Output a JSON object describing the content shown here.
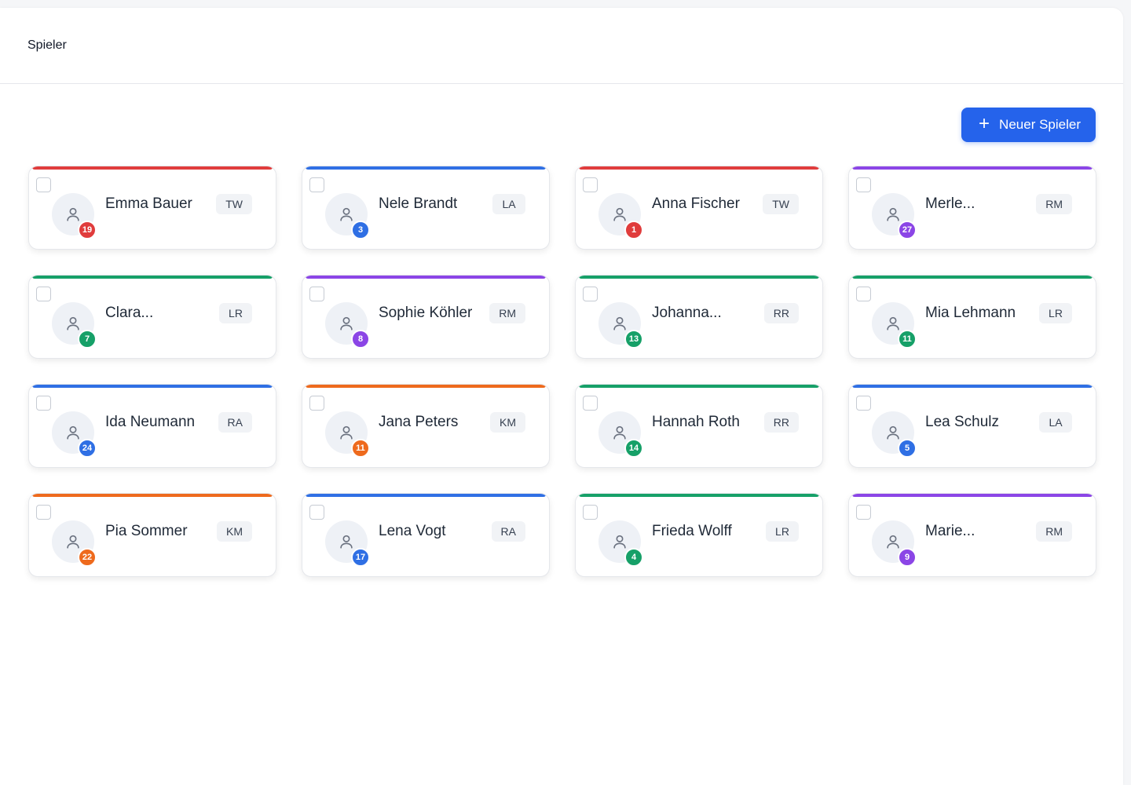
{
  "header": {
    "title": "Spieler"
  },
  "toolbar": {
    "new_player_label": "Neuer Spieler",
    "plus_icon": "plus-icon"
  },
  "colors": {
    "red": "#e03c3c",
    "blue": "#2f6fe4",
    "purple": "#8b45e6",
    "green": "#16a068",
    "orange": "#ee6a1d",
    "primary": "#2563eb"
  },
  "players": [
    {
      "name": "Emma Bauer",
      "position": "TW",
      "number": "19",
      "color": "red"
    },
    {
      "name": "Nele Brandt",
      "position": "LA",
      "number": "3",
      "color": "blue"
    },
    {
      "name": "Anna Fischer",
      "position": "TW",
      "number": "1",
      "color": "red"
    },
    {
      "name": "Merle...",
      "position": "RM",
      "number": "27",
      "color": "purple"
    },
    {
      "name": "Clara...",
      "position": "LR",
      "number": "7",
      "color": "green"
    },
    {
      "name": "Sophie Köhler",
      "position": "RM",
      "number": "8",
      "color": "purple"
    },
    {
      "name": "Johanna...",
      "position": "RR",
      "number": "13",
      "color": "green"
    },
    {
      "name": "Mia Lehmann",
      "position": "LR",
      "number": "11",
      "color": "green"
    },
    {
      "name": "Ida Neumann",
      "position": "RA",
      "number": "24",
      "color": "blue"
    },
    {
      "name": "Jana Peters",
      "position": "KM",
      "number": "11",
      "color": "orange"
    },
    {
      "name": "Hannah Roth",
      "position": "RR",
      "number": "14",
      "color": "green"
    },
    {
      "name": "Lea Schulz",
      "position": "LA",
      "number": "5",
      "color": "blue"
    },
    {
      "name": "Pia Sommer",
      "position": "KM",
      "number": "22",
      "color": "orange"
    },
    {
      "name": "Lena Vogt",
      "position": "RA",
      "number": "17",
      "color": "blue"
    },
    {
      "name": "Frieda Wolff",
      "position": "LR",
      "number": "4",
      "color": "green"
    },
    {
      "name": "Marie...",
      "position": "RM",
      "number": "9",
      "color": "purple"
    }
  ]
}
